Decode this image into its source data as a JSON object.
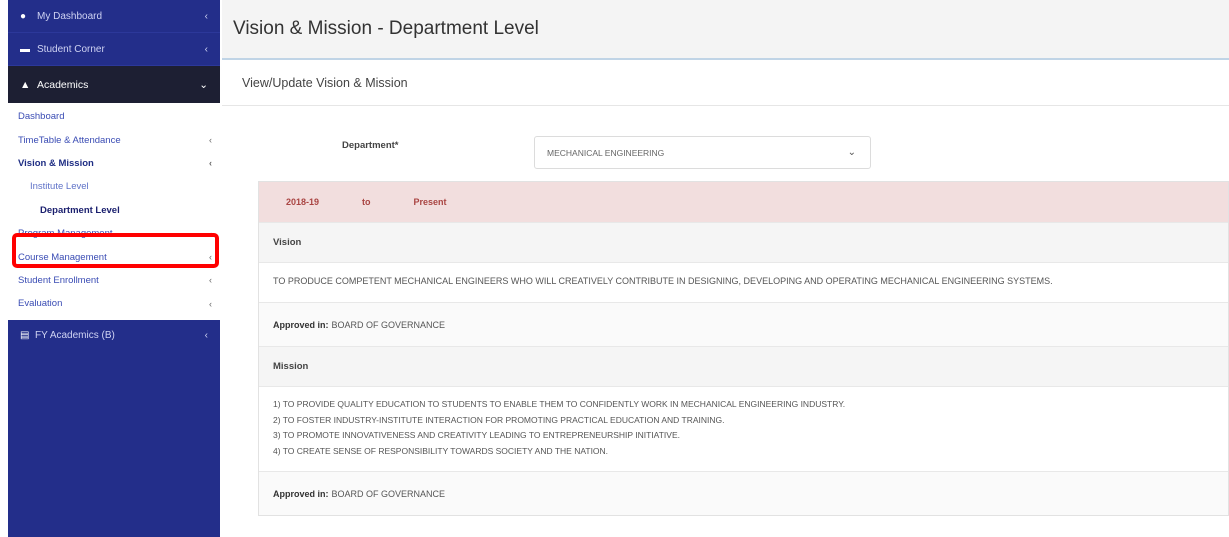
{
  "sidebar": {
    "top_items": [
      {
        "label": "My Dashboard",
        "icon": "dashboard-icon"
      },
      {
        "label": "Student Corner",
        "icon": "student-icon"
      }
    ],
    "active_section": {
      "label": "Academics",
      "icon": "academics-icon"
    },
    "sub_items": {
      "dashboard": "Dashboard",
      "timetable": "TimeTable & Attendance",
      "vision_mission": "Vision & Mission",
      "institute_level": "Institute Level",
      "department_level": "Department Level",
      "program_management": "Program Management",
      "course_management": "Course Management",
      "student_enrollment": "Student Enrollment",
      "evaluation": "Evaluation"
    },
    "bottom_item": {
      "label": "FY Academics (B)",
      "icon": "book-icon"
    }
  },
  "page": {
    "title": "Vision & Mission - Department Level",
    "card_title": "View/Update Vision & Mission"
  },
  "department": {
    "label": "Department*",
    "selected": "MECHANICAL ENGINEERING"
  },
  "period": {
    "from": "2018-19",
    "to_word": "to",
    "until": "Present"
  },
  "vision": {
    "heading": "Vision",
    "text": "TO PRODUCE COMPETENT MECHANICAL ENGINEERS WHO WILL CREATIVELY CONTRIBUTE IN DESIGNING, DEVELOPING AND OPERATING MECHANICAL ENGINEERING SYSTEMS.",
    "approved_label": "Approved in:",
    "approved_value": "BOARD OF GOVERNANCE"
  },
  "mission": {
    "heading": "Mission",
    "lines": [
      "1) TO PROVIDE QUALITY EDUCATION TO STUDENTS TO ENABLE THEM TO CONFIDENTLY WORK IN MECHANICAL ENGINEERING INDUSTRY.",
      "2) TO FOSTER INDUSTRY-INSTITUTE INTERACTION FOR PROMOTING PRACTICAL EDUCATION AND TRAINING.",
      "3) TO PROMOTE INNOVATIVENESS AND CREATIVITY LEADING TO ENTREPRENEURSHIP INITIATIVE.",
      "4) TO CREATE SENSE OF RESPONSIBILITY TOWARDS SOCIETY AND THE NATION."
    ],
    "approved_label": "Approved in:",
    "approved_value": "BOARD OF GOVERNANCE"
  },
  "colors": {
    "sidebar": "#232e8a",
    "active_section": "#1d1f33",
    "period_bar": "#f2dede",
    "period_text": "#a94442",
    "highlight_box": "#ff0000"
  }
}
